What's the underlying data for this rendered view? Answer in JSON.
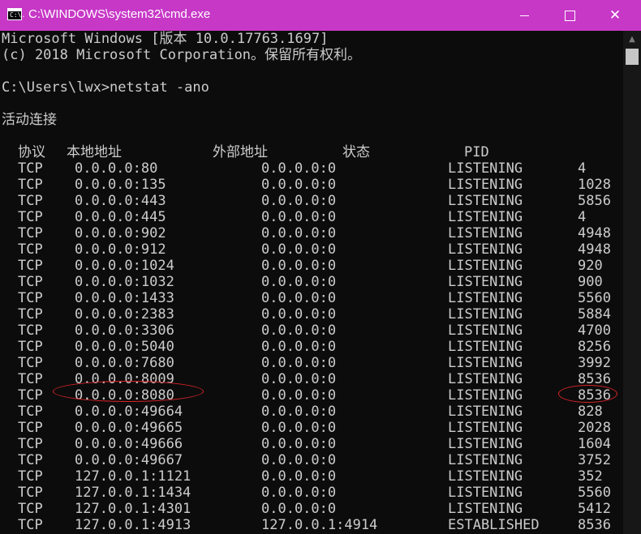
{
  "window": {
    "title": "C:\\WINDOWS\\system32\\cmd.exe",
    "app_icon_text": "C:\\.",
    "controls": {
      "minimize": "minimize",
      "maximize": "maximize",
      "close": "✕"
    },
    "title_bar_color": "#c738c7"
  },
  "console": {
    "banner_1": "Microsoft Windows [版本 10.0.17763.1697]",
    "banner_2": "(c) 2018 Microsoft Corporation。保留所有权利。",
    "prompt": "C:\\Users\\lwx>netstat -ano",
    "section_title": "活动连接",
    "headers": {
      "proto": "协议",
      "local": "本地地址",
      "foreign": "外部地址",
      "state": "状态",
      "pid": "PID"
    },
    "rows": [
      {
        "proto": "TCP",
        "local": "0.0.0.0:80",
        "foreign": "0.0.0.0:0",
        "state": "LISTENING",
        "pid": "4"
      },
      {
        "proto": "TCP",
        "local": "0.0.0.0:135",
        "foreign": "0.0.0.0:0",
        "state": "LISTENING",
        "pid": "1028"
      },
      {
        "proto": "TCP",
        "local": "0.0.0.0:443",
        "foreign": "0.0.0.0:0",
        "state": "LISTENING",
        "pid": "5856"
      },
      {
        "proto": "TCP",
        "local": "0.0.0.0:445",
        "foreign": "0.0.0.0:0",
        "state": "LISTENING",
        "pid": "4"
      },
      {
        "proto": "TCP",
        "local": "0.0.0.0:902",
        "foreign": "0.0.0.0:0",
        "state": "LISTENING",
        "pid": "4948"
      },
      {
        "proto": "TCP",
        "local": "0.0.0.0:912",
        "foreign": "0.0.0.0:0",
        "state": "LISTENING",
        "pid": "4948"
      },
      {
        "proto": "TCP",
        "local": "0.0.0.0:1024",
        "foreign": "0.0.0.0:0",
        "state": "LISTENING",
        "pid": "920"
      },
      {
        "proto": "TCP",
        "local": "0.0.0.0:1032",
        "foreign": "0.0.0.0:0",
        "state": "LISTENING",
        "pid": "900"
      },
      {
        "proto": "TCP",
        "local": "0.0.0.0:1433",
        "foreign": "0.0.0.0:0",
        "state": "LISTENING",
        "pid": "5560"
      },
      {
        "proto": "TCP",
        "local": "0.0.0.0:2383",
        "foreign": "0.0.0.0:0",
        "state": "LISTENING",
        "pid": "5884"
      },
      {
        "proto": "TCP",
        "local": "0.0.0.0:3306",
        "foreign": "0.0.0.0:0",
        "state": "LISTENING",
        "pid": "4700"
      },
      {
        "proto": "TCP",
        "local": "0.0.0.0:5040",
        "foreign": "0.0.0.0:0",
        "state": "LISTENING",
        "pid": "8256"
      },
      {
        "proto": "TCP",
        "local": "0.0.0.0:7680",
        "foreign": "0.0.0.0:0",
        "state": "LISTENING",
        "pid": "3992"
      },
      {
        "proto": "TCP",
        "local": "0.0.0.0:8009",
        "foreign": "0.0.0.0:0",
        "state": "LISTENING",
        "pid": "8536"
      },
      {
        "proto": "TCP",
        "local": "0.0.0.0:8080",
        "foreign": "0.0.0.0:0",
        "state": "LISTENING",
        "pid": "8536",
        "highlighted": true
      },
      {
        "proto": "TCP",
        "local": "0.0.0.0:49664",
        "foreign": "0.0.0.0:0",
        "state": "LISTENING",
        "pid": "828"
      },
      {
        "proto": "TCP",
        "local": "0.0.0.0:49665",
        "foreign": "0.0.0.0:0",
        "state": "LISTENING",
        "pid": "2028"
      },
      {
        "proto": "TCP",
        "local": "0.0.0.0:49666",
        "foreign": "0.0.0.0:0",
        "state": "LISTENING",
        "pid": "1604"
      },
      {
        "proto": "TCP",
        "local": "0.0.0.0:49667",
        "foreign": "0.0.0.0:0",
        "state": "LISTENING",
        "pid": "3752"
      },
      {
        "proto": "TCP",
        "local": "127.0.0.1:1121",
        "foreign": "0.0.0.0:0",
        "state": "LISTENING",
        "pid": "352"
      },
      {
        "proto": "TCP",
        "local": "127.0.0.1:1434",
        "foreign": "0.0.0.0:0",
        "state": "LISTENING",
        "pid": "5560"
      },
      {
        "proto": "TCP",
        "local": "127.0.0.1:4301",
        "foreign": "0.0.0.0:0",
        "state": "LISTENING",
        "pid": "5412"
      },
      {
        "proto": "TCP",
        "local": "127.0.0.1:4913",
        "foreign": "127.0.0.1:4914",
        "state": "ESTABLISHED",
        "pid": "8536"
      }
    ],
    "annotation_color": "#e0242a",
    "text_color": "#cccccc",
    "background_color": "#0c0c0c"
  }
}
